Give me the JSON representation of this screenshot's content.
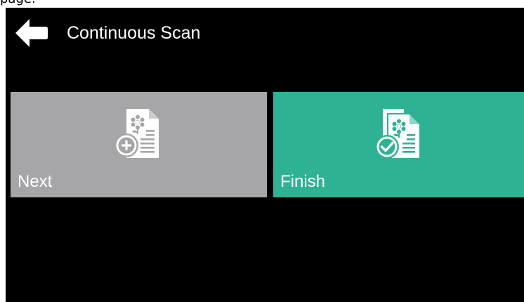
{
  "top_fragment": "page.",
  "header": {
    "title": "Continuous Scan",
    "back_icon": "back-arrow-icon"
  },
  "tiles": [
    {
      "label": "Next",
      "icon": "document-add-icon",
      "color": "#a6a5a8"
    },
    {
      "label": "Finish",
      "icon": "document-check-icon",
      "color": "#2fb294"
    }
  ],
  "colors": {
    "screen_bg": "#000000",
    "text": "#ffffff"
  }
}
